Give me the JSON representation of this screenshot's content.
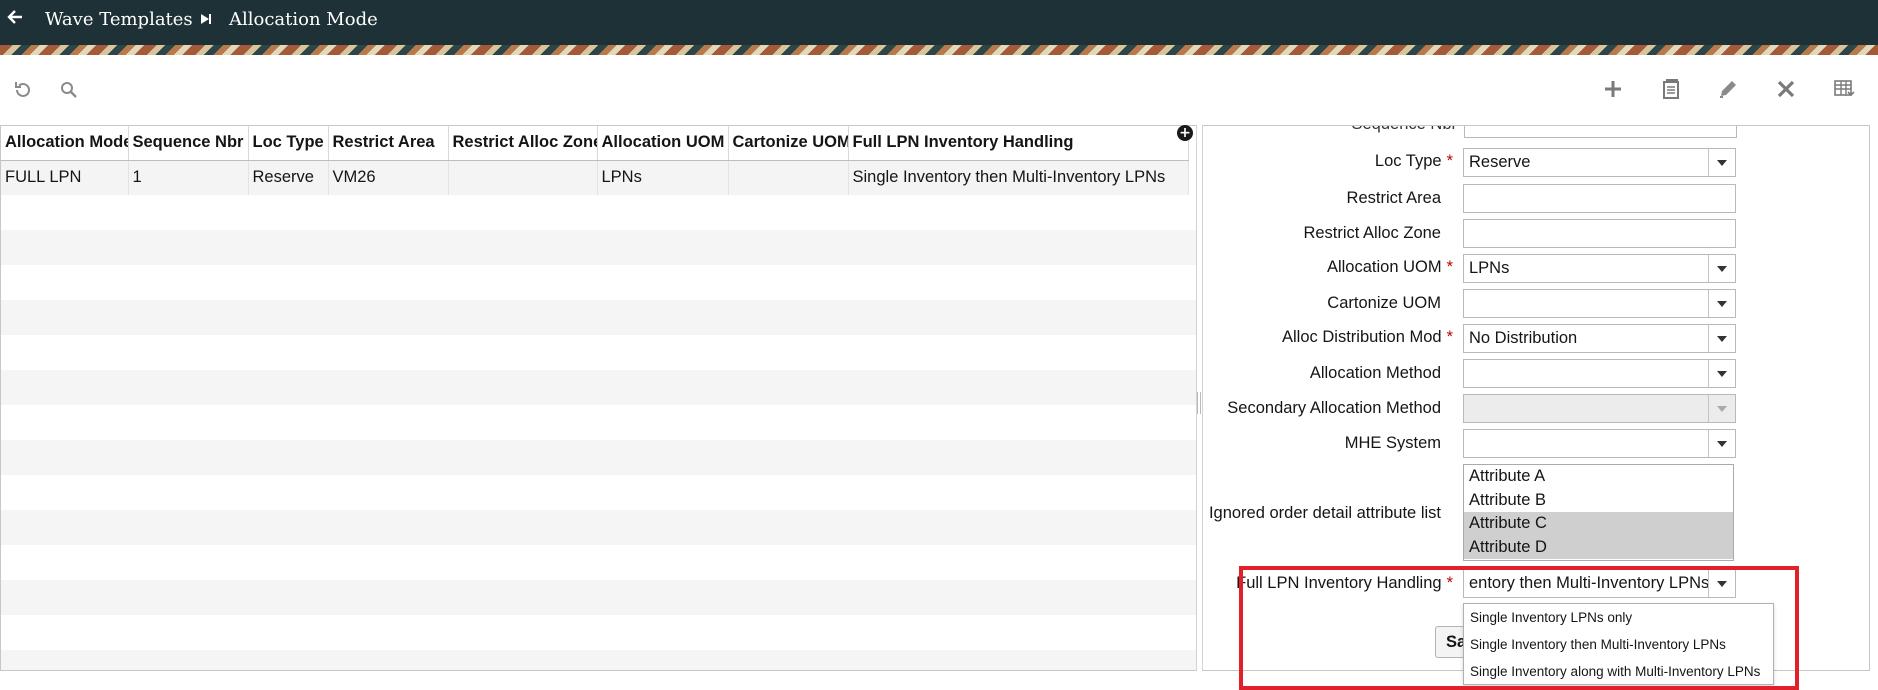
{
  "header": {
    "breadcrumb_parent": "Wave Templates",
    "breadcrumb_current": "Allocation Mode",
    "bg_color": "#1e3137"
  },
  "toolbar": {
    "left": [
      "refresh-icon",
      "search-icon"
    ],
    "right": [
      "add-icon",
      "copy-icon",
      "edit-icon",
      "delete-icon",
      "grid-columns-icon"
    ]
  },
  "grid": {
    "columns": [
      "Allocation Mode",
      "Sequence Nbr",
      "Loc Type",
      "Restrict Area",
      "Restrict Alloc Zone",
      "Allocation UOM",
      "Cartonize UOM",
      "Full LPN Inventory Handling"
    ],
    "rows": [
      [
        "FULL LPN",
        "1",
        "Reserve",
        "VM26",
        "",
        "LPNs",
        "",
        "Single Inventory then Multi-Inventory LPNs"
      ]
    ]
  },
  "form": {
    "partial_label": "Sequence Nbr",
    "fields": {
      "loc_type": {
        "label": "Loc Type",
        "value": "Reserve",
        "required": "*"
      },
      "restrict_area": {
        "label": "Restrict Area",
        "value": ""
      },
      "restrict_alloc_zone": {
        "label": "Restrict Alloc Zone",
        "value": ""
      },
      "allocation_uom": {
        "label": "Allocation UOM",
        "value": "LPNs",
        "required": "*"
      },
      "cartonize_uom": {
        "label": "Cartonize UOM",
        "value": ""
      },
      "alloc_distribution_mod": {
        "label": "Alloc Distribution Mod",
        "value": "No Distribution",
        "required": "*"
      },
      "allocation_method": {
        "label": "Allocation Method",
        "value": ""
      },
      "secondary_allocation_method": {
        "label": "Secondary Allocation Method",
        "value": ""
      },
      "mhe_system": {
        "label": "MHE System",
        "value": ""
      },
      "ignored_attributes": {
        "label": "Ignored order detail attribute list",
        "options": [
          "Attribute A",
          "Attribute B",
          "Attribute C",
          "Attribute D"
        ],
        "selected": [
          "Attribute C",
          "Attribute D"
        ]
      },
      "full_lpn_handling": {
        "label": "Full LPN Inventory Handling",
        "value": "entory then Multi-Inventory LPNs",
        "required": "*",
        "options": [
          "Single Inventory LPNs only",
          "Single Inventory then Multi-Inventory LPNs",
          "Single Inventory along with Multi-Inventory LPNs"
        ]
      }
    },
    "save_label": "Sa"
  },
  "colors": {
    "required": "#c00000",
    "highlight": "#e0212a"
  }
}
